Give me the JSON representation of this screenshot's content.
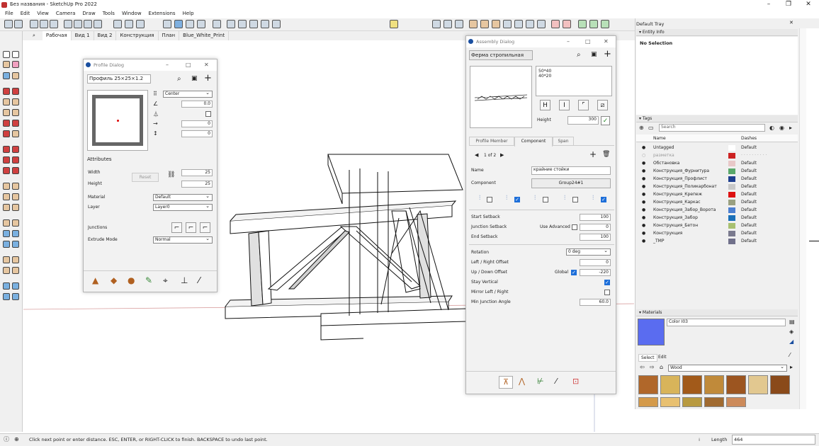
{
  "app": {
    "title": "Без названия - SketchUp Pro 2022",
    "minimize": "–",
    "maximize": "❐",
    "close": "✕"
  },
  "menu": [
    "File",
    "Edit",
    "View",
    "Camera",
    "Draw",
    "Tools",
    "Window",
    "Extensions",
    "Help"
  ],
  "scene_tabs": [
    "Рабочая",
    "Вид 1",
    "Вид 2",
    "Конструкция",
    "План",
    "Blue_White_Print"
  ],
  "profile_dialog": {
    "title": "Profile Dialog",
    "profile_name": "Профиль 25×25×1.2",
    "align": "Center",
    "rotation": "0.0",
    "offset_x": "0",
    "offset_y": "0",
    "attributes_label": "Attributes",
    "width_label": "Width",
    "height_label": "Height",
    "width": "25",
    "height": "25",
    "reset": "Reset",
    "material_label": "Material",
    "material": "Default",
    "layer_label": "Layer",
    "layer": "Layer0",
    "junctions_label": "Junctions",
    "extrude_label": "Extrude Mode",
    "extrude": "Normal"
  },
  "assembly_dialog": {
    "title": "Assembly Dialog",
    "assembly_name": "Ферма стропильная",
    "notes": "50*40\n40*20",
    "height_label": "Height",
    "height": "300",
    "tabs": [
      "Profile Member",
      "Component",
      "Span"
    ],
    "paging": "1 of 2",
    "name_label": "Name",
    "name": "крайние стойки",
    "component_label": "Component",
    "component": "Group24#1",
    "start_setback_label": "Start Setback",
    "start_setback": "100",
    "junction_setback_label": "Junction Setback",
    "use_advanced": "Use Advanced",
    "junction_setback": "0",
    "end_setback_label": "End Setback",
    "end_setback": "100",
    "rotation_label": "Rotation",
    "rotation": "0 deg",
    "lr_offset_label": "Left / Right Offset",
    "lr_offset": "0",
    "ud_offset_label": "Up / Down Offset",
    "global_label": "Global",
    "ud_offset": "-220",
    "stay_vertical": "Stay Vertical",
    "mirror": "Mirror Left / Right",
    "min_angle_label": "Min Junction Angle",
    "min_angle": "60.0"
  },
  "tray": {
    "title": "Default Tray",
    "entity_info": "Entity Info",
    "no_selection": "No Selection",
    "tags_title": "Tags",
    "search_placeholder": "Search",
    "col_name": "Name",
    "col_dashes": "Dashes",
    "tags": [
      {
        "name": "Untagged",
        "dash": "Default",
        "color": "#ffffff",
        "vis": "●"
      },
      {
        "name": "разметка",
        "dash": "· · · · · · · · · ·",
        "color": "#cc2222",
        "vis": "○"
      },
      {
        "name": "Обстановка",
        "dash": "Default",
        "color": "#e8c8c8",
        "vis": "●"
      },
      {
        "name": "Конструкция_Фурнитура",
        "dash": "Default",
        "color": "#5aa86a",
        "vis": "●"
      },
      {
        "name": "Конструкция_Профлист",
        "dash": "Default",
        "color": "#1f3f8f",
        "vis": "●"
      },
      {
        "name": "Конструкция_Поликарбонат",
        "dash": "Default",
        "color": "#c8c8c8",
        "vis": "●"
      },
      {
        "name": "Конструкция_Крепеж",
        "dash": "Default",
        "color": "#dd1111",
        "vis": "●"
      },
      {
        "name": "Конструкция_Каркас",
        "dash": "Default",
        "color": "#9aa080",
        "vis": "●"
      },
      {
        "name": "Конструкция_Забор_Ворота",
        "dash": "Default",
        "color": "#4c7fd0",
        "vis": "●"
      },
      {
        "name": "Конструкция_Забор",
        "dash": "Default",
        "color": "#1a6fb8",
        "vis": "●"
      },
      {
        "name": "Конструкция_Бетон",
        "dash": "Default",
        "color": "#a8c070",
        "vis": "●"
      },
      {
        "name": "Конструкция",
        "dash": "Default",
        "color": "#7a7a8e",
        "vis": "●"
      },
      {
        "name": "_TMP",
        "dash": "Default",
        "color": "#70708a",
        "vis": "●"
      }
    ],
    "materials_title": "Materials",
    "material_name": "Color I03",
    "select_tab": "Select",
    "edit_tab": "Edit",
    "collection": "Wood",
    "swatches": [
      "#b0672a",
      "#d8b45a",
      "#a25a1a",
      "#c08a3a",
      "#9c5520",
      "#e2c890",
      "#8a4a1a",
      "#d49a4a",
      "#e8c070",
      "#b89a40",
      "#a06a30",
      "#cc8a5a"
    ]
  },
  "status": {
    "hint": "Click next point or enter distance. ESC, ENTER, or RIGHT-CLICK to finish. BACKSPACE to undo last point.",
    "length_label": "Length",
    "length": "464"
  }
}
